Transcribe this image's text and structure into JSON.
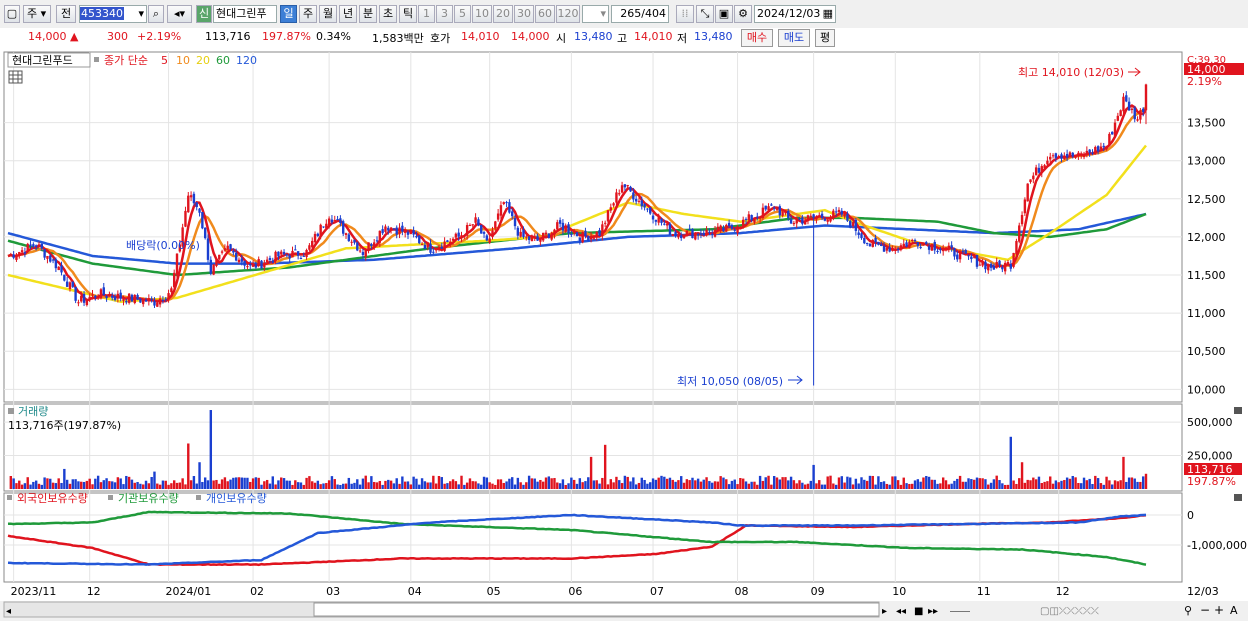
{
  "toolbar": {
    "market": "주",
    "period_type": "전",
    "code": "453340",
    "name_tag": "신",
    "name": "현대그린푸",
    "periods": [
      "일",
      "주",
      "월",
      "년",
      "분",
      "초",
      "틱"
    ],
    "active_period": "일",
    "counts": [
      "1",
      "3",
      "5",
      "10",
      "20",
      "30",
      "60",
      "120"
    ],
    "view_count": "265",
    "view_total": "/404",
    "date": "2024/12/03"
  },
  "quote": {
    "price": "14,000 ▲",
    "change": "300",
    "change_pct": "+2.19%",
    "volume": "113,716",
    "volume_pct": "197.87%",
    "turnover": "0.34%",
    "amount": "1,583백만",
    "bid_label": "호가",
    "bid": "14,010",
    "ask": "14,000",
    "open_label": "시",
    "open": "13,480",
    "high_label": "고",
    "high": "14,010",
    "low_label": "저",
    "low": "13,480",
    "buy_label": "매수",
    "sell_label": "매도",
    "eval_label": "평"
  },
  "legend": {
    "stock": "현대그린푸드",
    "series": "종가 단순",
    "ma": [
      "5",
      "10",
      "20",
      "60",
      "120"
    ]
  },
  "colors": {
    "up": "#e0141e",
    "down": "#1a3fd0",
    "ma5": "#e0141e",
    "ma10": "#f08a1c",
    "ma20": "#f2e01c",
    "ma60": "#1f9a3a",
    "ma120": "#2458d8"
  },
  "annotations": {
    "high": "최고 14,010 (12/03)",
    "low": "최저 10,050 (08/05)",
    "dividend": "배당락(0.00%)"
  },
  "right_axis": {
    "c_label": "C:39.30",
    "last_price": "14,000",
    "last_pct": "2.19%",
    "vol_last": "113,716",
    "vol_pct": "197.87%"
  },
  "volume_panel": {
    "title": "거래량",
    "info": "113,716주(197.87%)"
  },
  "holdings_panel": {
    "labels": [
      "외국인보유수량",
      "기관보유수량",
      "개인보유수량"
    ]
  },
  "chart_data": [
    {
      "type": "candlestick",
      "y_ticks": [
        "13,500",
        "13,000",
        "12,500",
        "12,000",
        "11,500",
        "11,000",
        "10,500",
        "10,000"
      ],
      "ylim": [
        9860,
        14400
      ],
      "x_labels": [
        "2023/11",
        "12",
        "2024/01",
        "02",
        "03",
        "04",
        "05",
        "06",
        "07",
        "08",
        "09",
        "10",
        "11",
        "12",
        "12/03"
      ],
      "close_anchors": [
        [
          0,
          11750
        ],
        [
          10,
          11900
        ],
        [
          18,
          11600
        ],
        [
          25,
          11150
        ],
        [
          32,
          11250
        ],
        [
          42,
          11200
        ],
        [
          52,
          11150
        ],
        [
          58,
          11300
        ],
        [
          64,
          12550
        ],
        [
          68,
          12350
        ],
        [
          72,
          11550
        ],
        [
          78,
          11850
        ],
        [
          86,
          11600
        ],
        [
          96,
          11750
        ],
        [
          106,
          11800
        ],
        [
          114,
          12300
        ],
        [
          120,
          12050
        ],
        [
          126,
          11800
        ],
        [
          134,
          12150
        ],
        [
          142,
          12050
        ],
        [
          150,
          11850
        ],
        [
          160,
          12000
        ],
        [
          166,
          12200
        ],
        [
          170,
          11900
        ],
        [
          176,
          12450
        ],
        [
          182,
          12000
        ],
        [
          188,
          11950
        ],
        [
          196,
          12150
        ],
        [
          204,
          12000
        ],
        [
          210,
          12050
        ],
        [
          218,
          12700
        ],
        [
          226,
          12400
        ],
        [
          236,
          12050
        ],
        [
          246,
          12050
        ],
        [
          256,
          12100
        ],
        [
          264,
          12250
        ],
        [
          272,
          12400
        ],
        [
          278,
          12200
        ],
        [
          286,
          12250
        ],
        [
          296,
          12300
        ],
        [
          306,
          11900
        ],
        [
          314,
          11850
        ],
        [
          322,
          11950
        ],
        [
          332,
          11850
        ],
        [
          342,
          11700
        ],
        [
          350,
          11600
        ],
        [
          356,
          11650
        ],
        [
          362,
          12700
        ],
        [
          370,
          13100
        ],
        [
          380,
          13050
        ],
        [
          390,
          13200
        ],
        [
          396,
          13800
        ],
        [
          401,
          13550
        ],
        [
          403,
          13700
        ],
        [
          404,
          14000
        ]
      ],
      "ma": {
        "ma20": [
          [
            0,
            11500
          ],
          [
            40,
            11150
          ],
          [
            60,
            11200
          ],
          [
            120,
            11850
          ],
          [
            170,
            11950
          ],
          [
            190,
            12000
          ],
          [
            220,
            12450
          ],
          [
            240,
            12300
          ],
          [
            260,
            12200
          ],
          [
            290,
            12350
          ],
          [
            300,
            12200
          ],
          [
            320,
            11950
          ],
          [
            340,
            11800
          ],
          [
            355,
            11700
          ],
          [
            370,
            12050
          ],
          [
            390,
            12550
          ],
          [
            404,
            13200
          ]
        ],
        "ma60": [
          [
            0,
            11950
          ],
          [
            30,
            11650
          ],
          [
            60,
            11500
          ],
          [
            100,
            11600
          ],
          [
            150,
            11850
          ],
          [
            200,
            12050
          ],
          [
            250,
            12100
          ],
          [
            280,
            12250
          ],
          [
            300,
            12250
          ],
          [
            330,
            12200
          ],
          [
            350,
            12050
          ],
          [
            370,
            12000
          ],
          [
            390,
            12100
          ],
          [
            404,
            12300
          ]
        ],
        "ma120": [
          [
            0,
            12050
          ],
          [
            30,
            11750
          ],
          [
            60,
            11650
          ],
          [
            90,
            11650
          ],
          [
            130,
            11700
          ],
          [
            180,
            11850
          ],
          [
            220,
            12000
          ],
          [
            260,
            12050
          ],
          [
            290,
            12150
          ],
          [
            320,
            12100
          ],
          [
            350,
            12050
          ],
          [
            380,
            12100
          ],
          [
            404,
            12300
          ]
        ]
      },
      "high": {
        "value": 14010,
        "date": "12/03",
        "index": 404
      },
      "low": {
        "value": 10050,
        "date": "08/05",
        "index": 286
      }
    },
    {
      "type": "bar",
      "title": "거래량",
      "y_ticks": [
        "500,000",
        "250,000"
      ],
      "ylim": [
        0,
        620000
      ],
      "last_value": 113716
    },
    {
      "type": "line",
      "series_names": [
        "외국인보유수량",
        "기관보유수량",
        "개인보유수량"
      ],
      "y_ticks": [
        "0",
        "-1,000,000"
      ]
    }
  ]
}
